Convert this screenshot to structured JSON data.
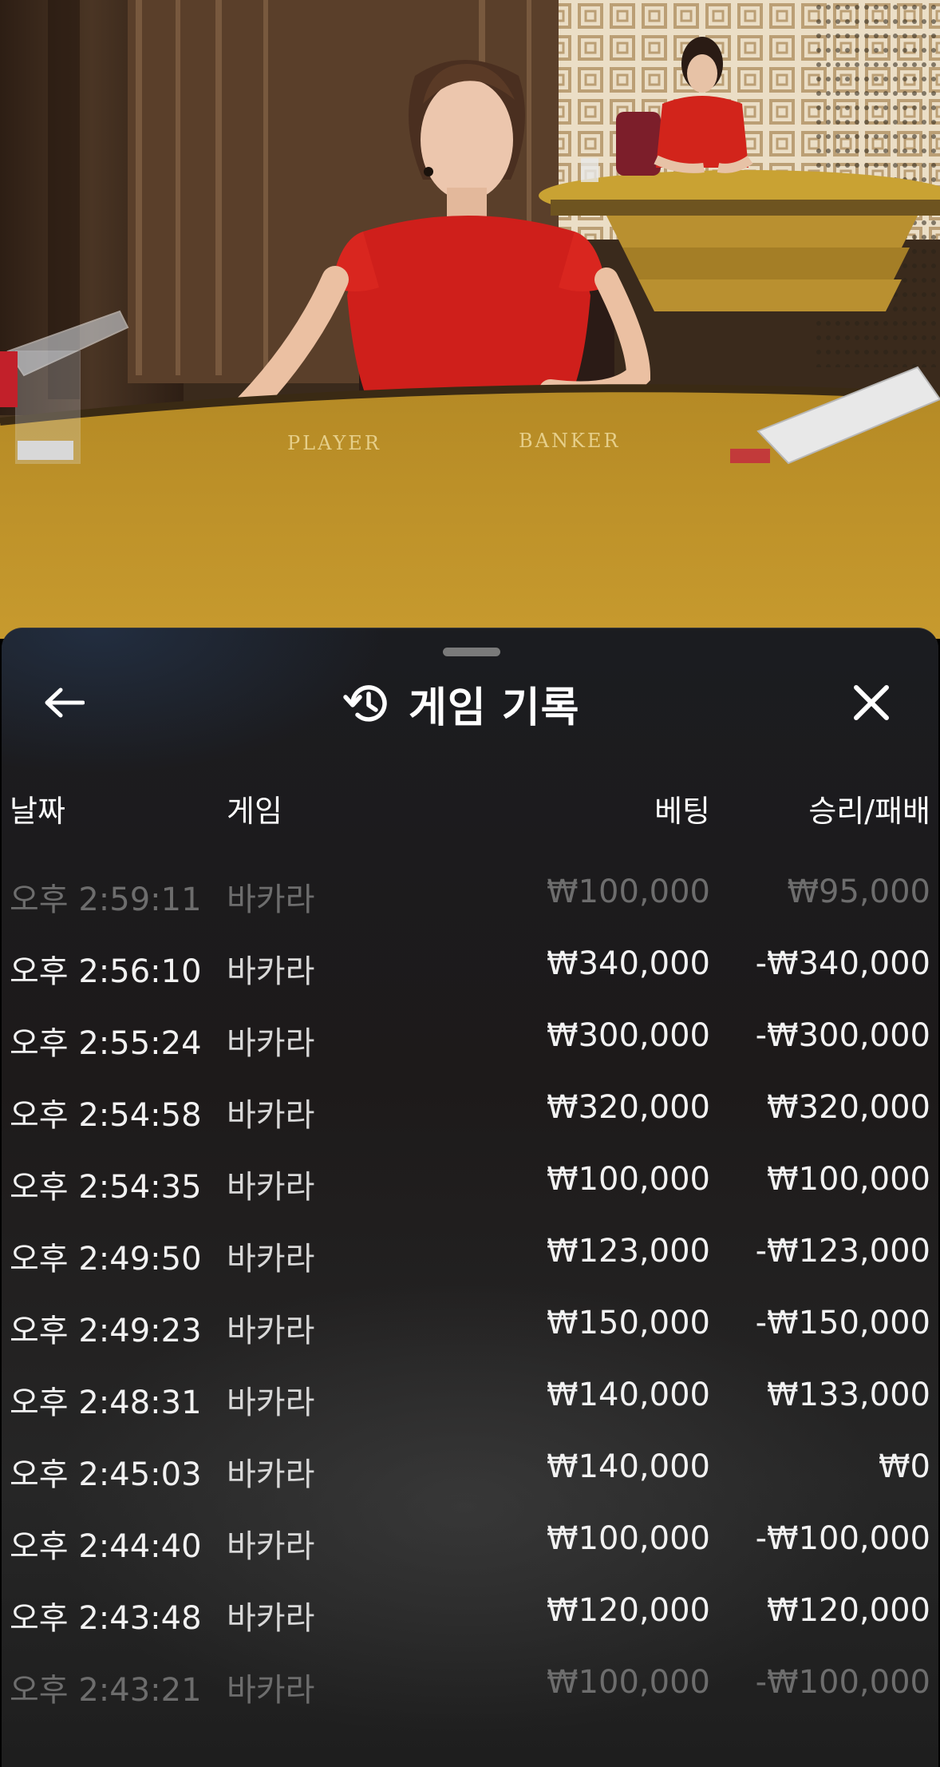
{
  "scene": {
    "table_labels": {
      "player": "PLAYER",
      "banker": "BANKER"
    }
  },
  "sheet": {
    "title": "게임 기록",
    "icons": {
      "back": "arrow-left-icon",
      "history": "history-icon",
      "close": "close-icon"
    }
  },
  "table": {
    "headers": {
      "date": "날짜",
      "game": "게임",
      "bet": "베팅",
      "win_loss": "승리/패배"
    },
    "rows": [
      {
        "time": "오후 2:59:11",
        "game": "바카라",
        "bet": "₩100,000",
        "result": "₩95,000"
      },
      {
        "time": "오후 2:56:10",
        "game": "바카라",
        "bet": "₩340,000",
        "result": "-₩340,000"
      },
      {
        "time": "오후 2:55:24",
        "game": "바카라",
        "bet": "₩300,000",
        "result": "-₩300,000"
      },
      {
        "time": "오후 2:54:58",
        "game": "바카라",
        "bet": "₩320,000",
        "result": "₩320,000"
      },
      {
        "time": "오후 2:54:35",
        "game": "바카라",
        "bet": "₩100,000",
        "result": "₩100,000"
      },
      {
        "time": "오후 2:49:50",
        "game": "바카라",
        "bet": "₩123,000",
        "result": "-₩123,000"
      },
      {
        "time": "오후 2:49:23",
        "game": "바카라",
        "bet": "₩150,000",
        "result": "-₩150,000"
      },
      {
        "time": "오후 2:48:31",
        "game": "바카라",
        "bet": "₩140,000",
        "result": "₩133,000"
      },
      {
        "time": "오후 2:45:03",
        "game": "바카라",
        "bet": "₩140,000",
        "result": "₩0"
      },
      {
        "time": "오후 2:44:40",
        "game": "바카라",
        "bet": "₩100,000",
        "result": "-₩100,000"
      },
      {
        "time": "오후 2:43:48",
        "game": "바카라",
        "bet": "₩120,000",
        "result": "₩120,000"
      },
      {
        "time": "오후 2:43:21",
        "game": "바카라",
        "bet": "₩100,000",
        "result": "-₩100,000"
      }
    ]
  }
}
